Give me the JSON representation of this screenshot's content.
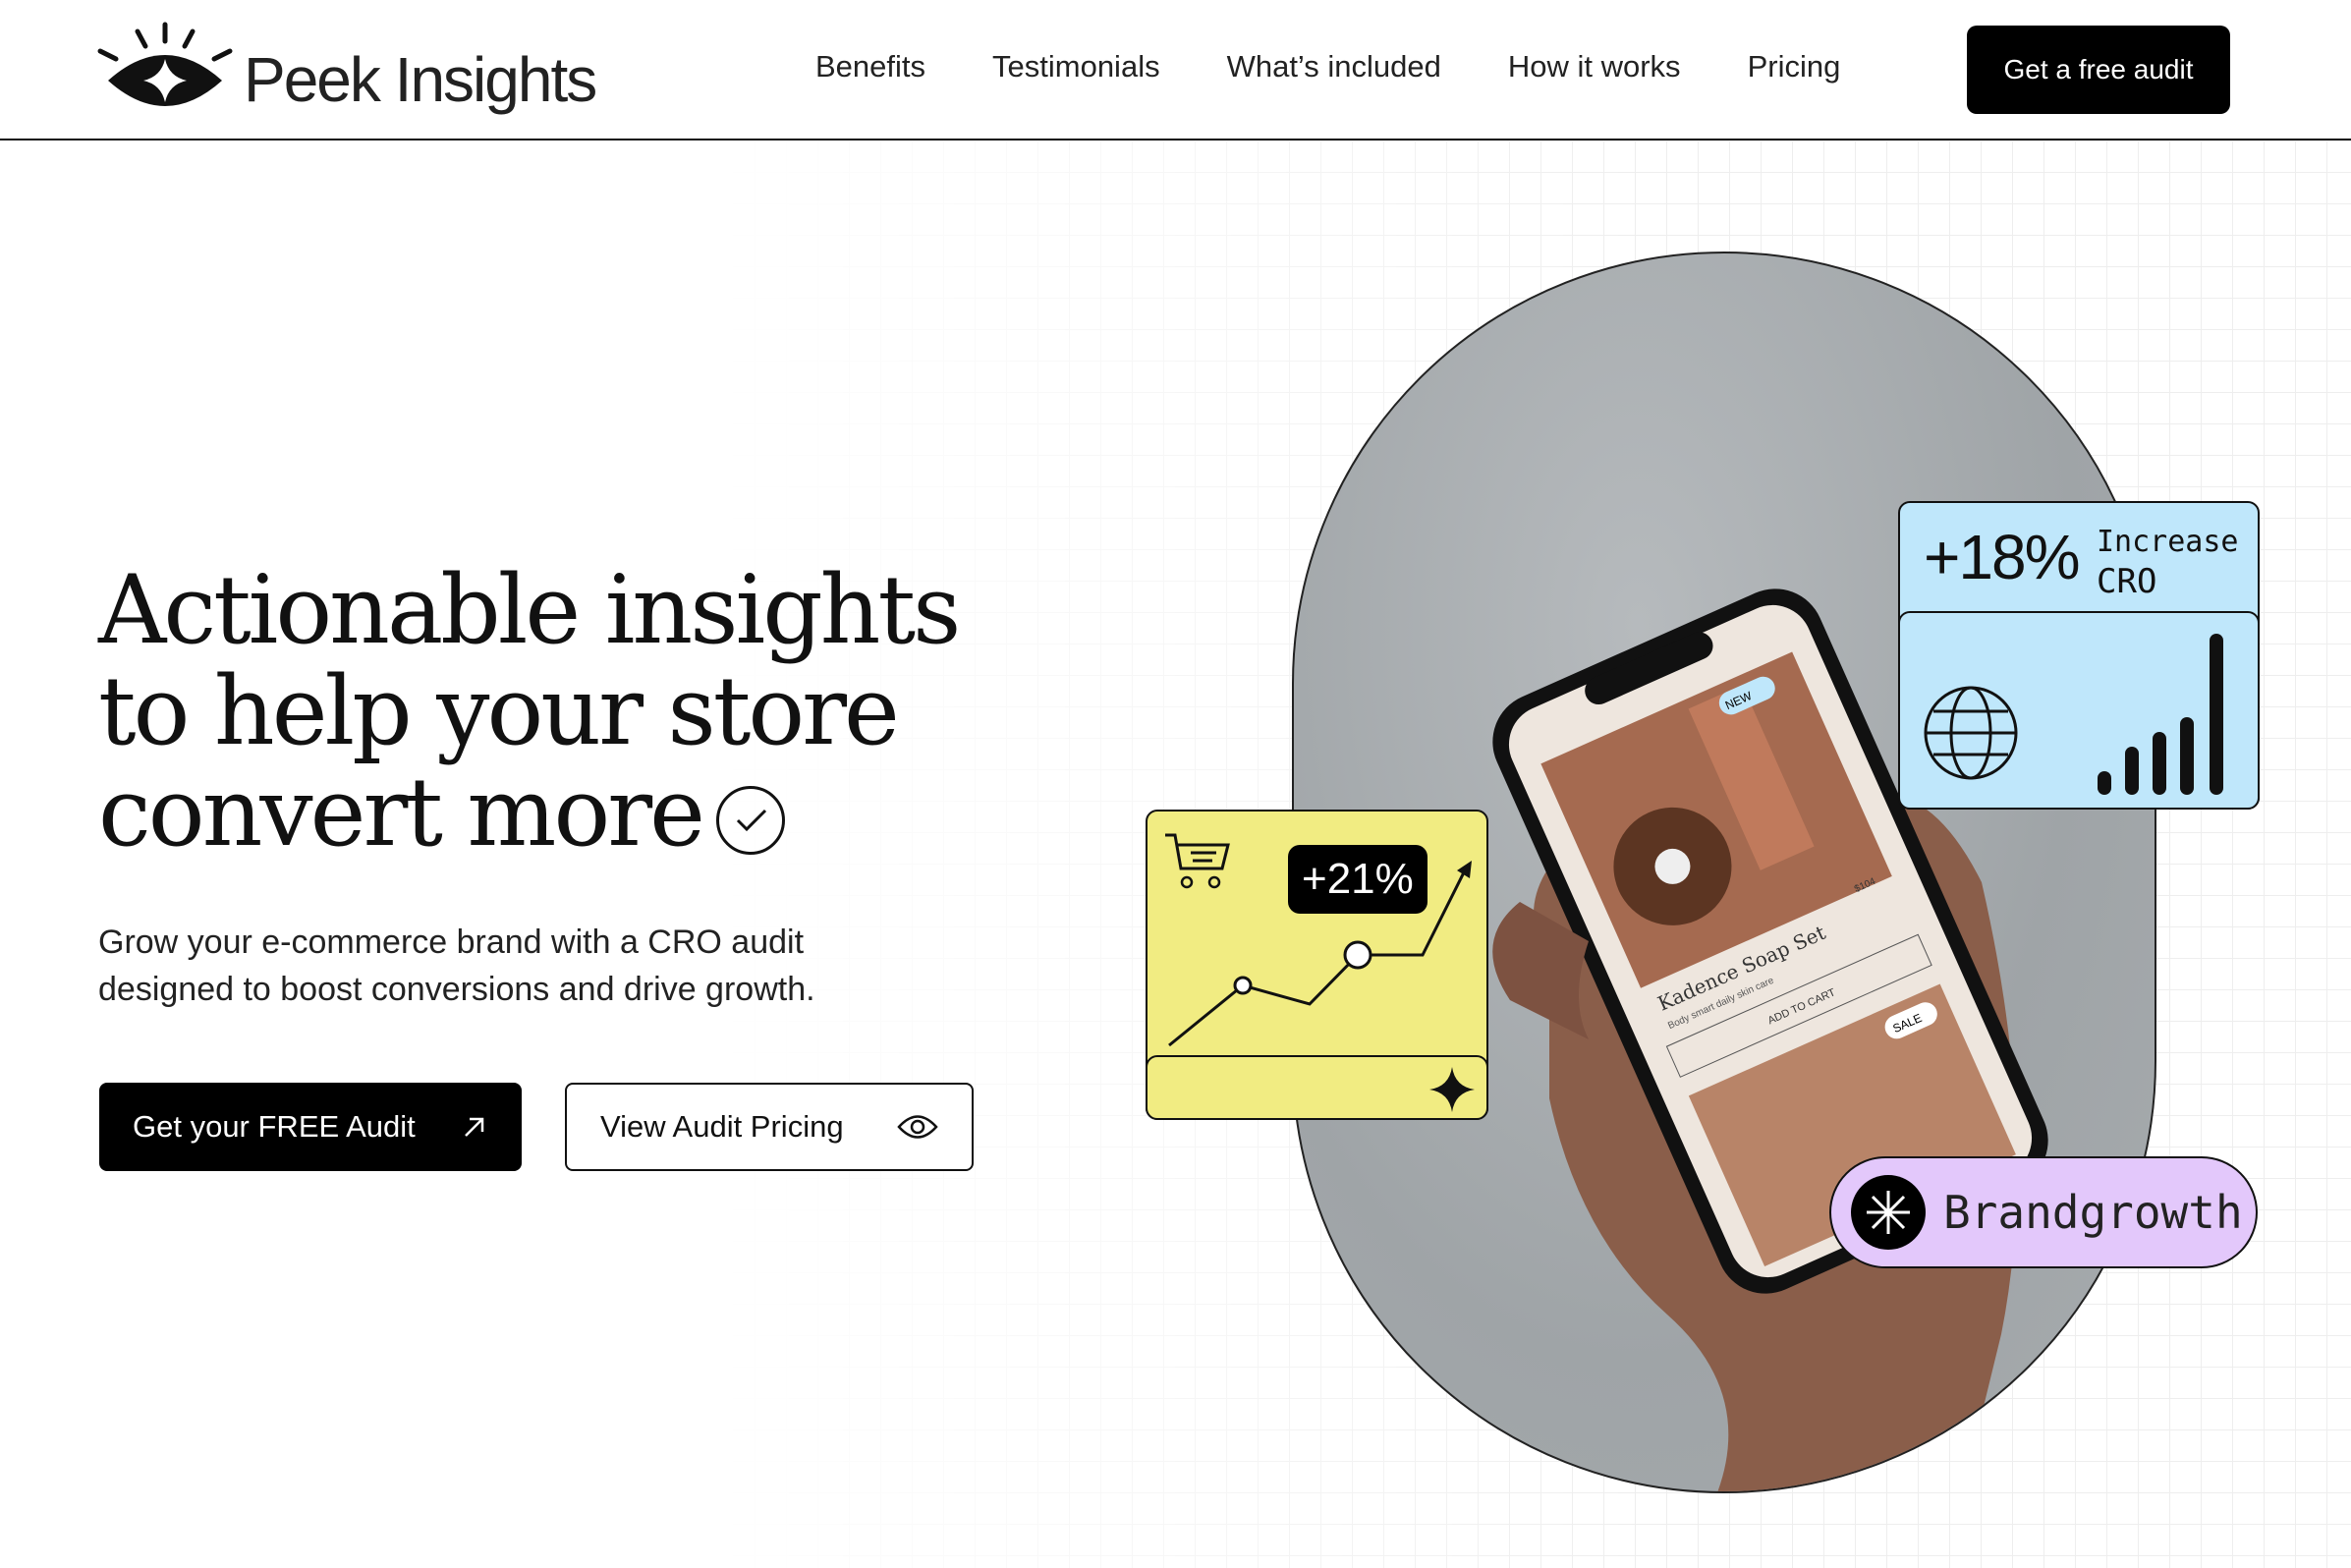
{
  "brand": {
    "name": "Peek Insights",
    "logo_icon": "eye-star-icon"
  },
  "nav": {
    "items": [
      "Benefits",
      "Testimonials",
      "What’s included",
      "How it works",
      "Pricing"
    ],
    "cta": "Get a free audit"
  },
  "hero": {
    "headline_lines": [
      "Actionable insights",
      "to help your store",
      "convert more"
    ],
    "subtitle_lines": [
      "Grow your e-commerce brand with a CRO audit",
      "designed to boost conversions and drive growth."
    ],
    "primary_button": "Get your FREE Audit",
    "primary_icon": "arrow-up-right-icon",
    "secondary_button": "View Audit Pricing",
    "secondary_icon": "eye-icon"
  },
  "visual": {
    "conversion_badge": "+21%",
    "cro_stat": {
      "value": "+18%",
      "label_line1": "Increase",
      "label_line2": "CRO"
    },
    "brand_pill": "Brandgrowth",
    "phone": {
      "product_name": "Kadence Soap Set",
      "product_desc": "Body smart daily skin care",
      "price": "$104",
      "add_to_cart": "ADD TO CART",
      "badge_new": "NEW",
      "badge_sale": "SALE"
    }
  },
  "colors": {
    "yellow": "#f1ec82",
    "blue": "#bfe7fb",
    "purple": "#e3c8fb",
    "black": "#000000"
  }
}
